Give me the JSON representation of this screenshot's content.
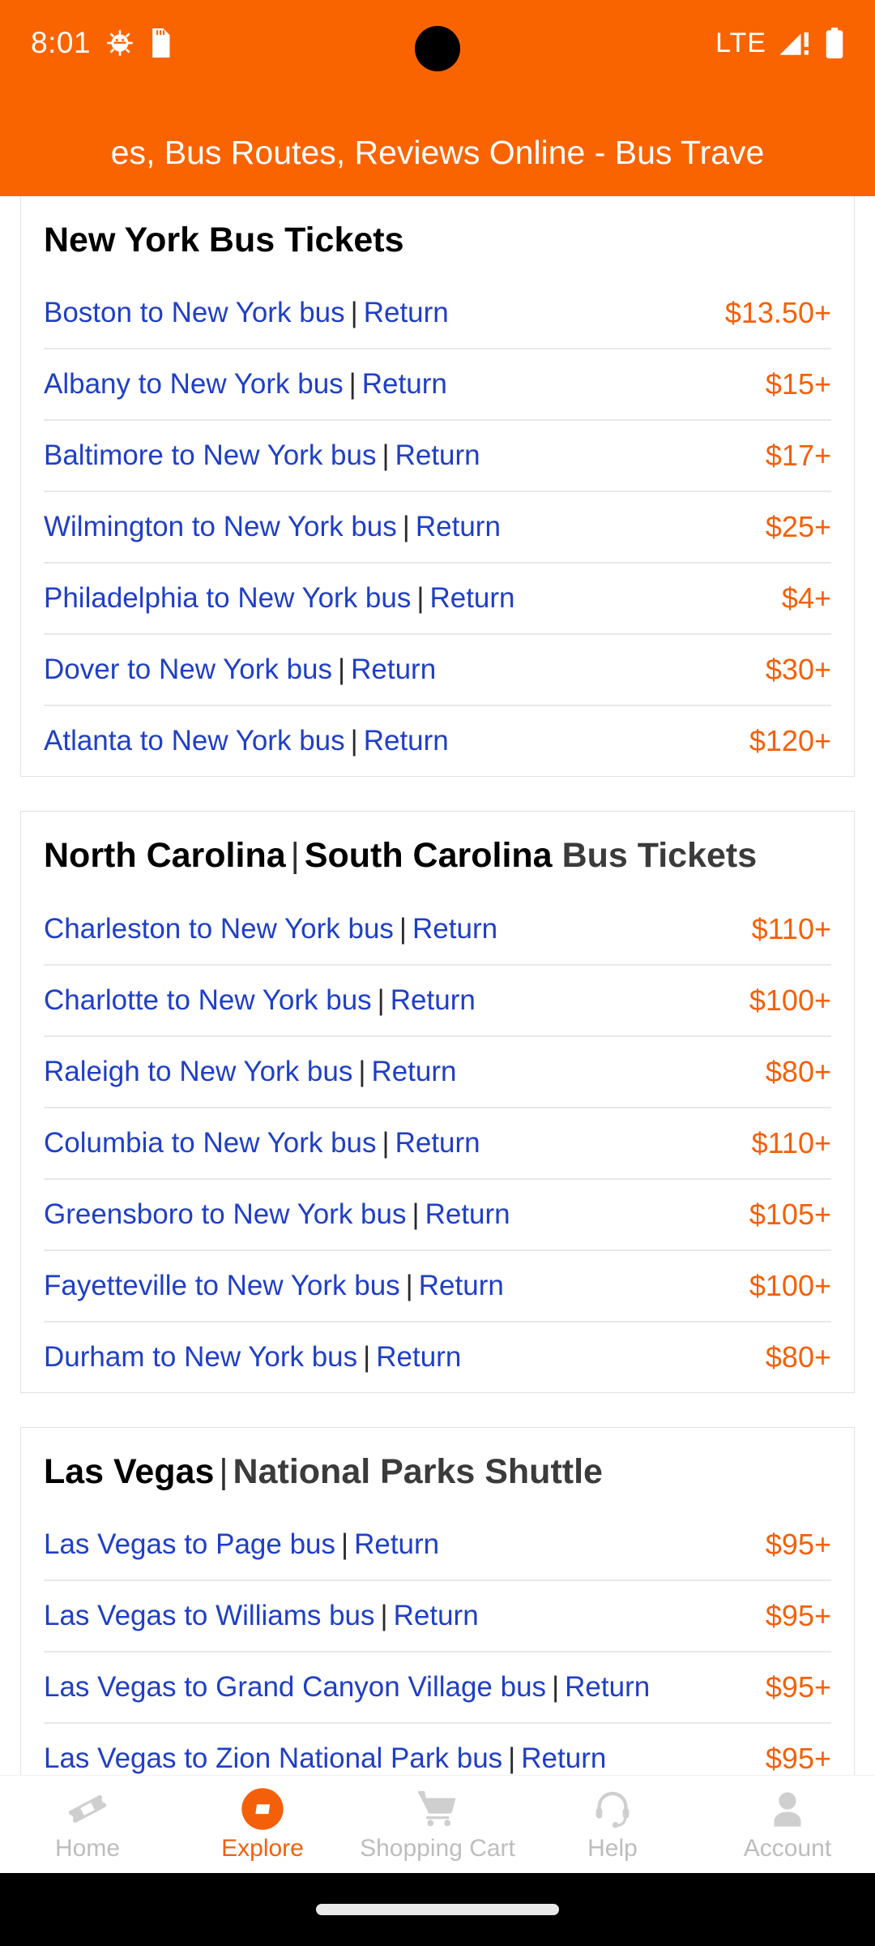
{
  "status_bar": {
    "time": "8:01",
    "network_label": "LTE",
    "icons": [
      "android-debug-icon",
      "sd-card-icon",
      "signal-bars-icon",
      "battery-icon"
    ]
  },
  "app_bar": {
    "title": "es, Bus Routes, Reviews Online - Bus Trave",
    "background_color": "#FA6400",
    "text_color": "#FFFFFF"
  },
  "theme": {
    "accent_orange": "#F4600A",
    "link_blue": "#1F3FC6",
    "header_orange": "#FA6400",
    "muted_gray": "#BDBDBD",
    "divider_gray": "#E8E8E8"
  },
  "sections": [
    {
      "title_primary": "New York Bus Tickets",
      "title_secondary": "",
      "has_separator": false,
      "rows": [
        {
          "route": "Boston to New York bus",
          "link2": "Return",
          "price": "$13.50+"
        },
        {
          "route": "Albany to New York bus",
          "link2": "Return",
          "price": "$15+"
        },
        {
          "route": "Baltimore to New York bus",
          "link2": "Return",
          "price": "$17+"
        },
        {
          "route": "Wilmington to New York bus",
          "link2": "Return",
          "price": "$25+"
        },
        {
          "route": "Philadelphia to New York bus",
          "link2": "Return",
          "price": "$4+"
        },
        {
          "route": "Dover to New York bus",
          "link2": "Return",
          "price": "$30+"
        },
        {
          "route": "Atlanta to New York bus",
          "link2": "Return",
          "price": "$120+"
        }
      ]
    },
    {
      "title_primary": "North Carolina",
      "title_mid": "South Carolina",
      "title_secondary": "Bus Tickets",
      "has_separator": true,
      "rows": [
        {
          "route": "Charleston to New York bus",
          "link2": "Return",
          "price": "$110+"
        },
        {
          "route": "Charlotte to New York bus",
          "link2": "Return",
          "price": "$100+"
        },
        {
          "route": "Raleigh to New York bus",
          "link2": "Return",
          "price": "$80+"
        },
        {
          "route": "Columbia to New York bus",
          "link2": "Return",
          "price": "$110+"
        },
        {
          "route": "Greensboro to New York bus",
          "link2": "Return",
          "price": "$105+"
        },
        {
          "route": "Fayetteville to New York bus",
          "link2": "Return",
          "price": "$100+"
        },
        {
          "route": "Durham to New York bus",
          "link2": "Return",
          "price": "$80+"
        }
      ]
    },
    {
      "title_primary": "Las Vegas",
      "title_secondary": "National Parks Shuttle",
      "has_separator": true,
      "rows": [
        {
          "route": "Las Vegas to Page bus",
          "link2": "Return",
          "price": "$95+"
        },
        {
          "route": "Las Vegas to Williams bus",
          "link2": "Return",
          "price": "$95+"
        },
        {
          "route": "Las Vegas to Grand Canyon Village bus",
          "link2": "Return",
          "price": "$95+"
        },
        {
          "route": "Las Vegas to Zion National Park bus",
          "link2": "Return",
          "price": "$95+"
        }
      ]
    }
  ],
  "separator_char": "|",
  "bottom_nav": {
    "items": [
      {
        "label": "Home",
        "icon": "ticket-icon",
        "active": false
      },
      {
        "label": "Explore",
        "icon": "compass-icon",
        "active": true
      },
      {
        "label": "Shopping Cart",
        "icon": "cart-icon",
        "active": false
      },
      {
        "label": "Help",
        "icon": "headset-icon",
        "active": false
      },
      {
        "label": "Account",
        "icon": "person-icon",
        "active": false
      }
    ]
  }
}
